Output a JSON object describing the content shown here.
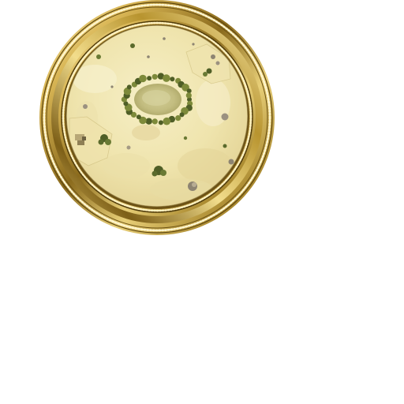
{
  "minimap": {
    "frame_style": "ornate-gold-bead-border",
    "terrain": "desert-sand",
    "colors": {
      "gold_light": "#f4e6a4",
      "gold_mid": "#c9a640",
      "gold_dark": "#6e5412",
      "sand_light": "#f4ecbe",
      "sand_mid": "#e9dca2",
      "oasis_water": "#c9c48a",
      "tree_dark": "#4f5e26",
      "tree_light": "#7d8a3a",
      "rock": "#8d8472"
    },
    "features": [
      {
        "type": "oasis-pond",
        "icon": "oasis-icon"
      },
      {
        "type": "tree-ring",
        "icon": "tree-ring-icon"
      },
      {
        "type": "settlement",
        "icon": "village-icon"
      },
      {
        "type": "rock-outcrop",
        "icon": "rock-icon"
      },
      {
        "type": "tree-cluster",
        "icon": "tree-icon"
      }
    ]
  }
}
